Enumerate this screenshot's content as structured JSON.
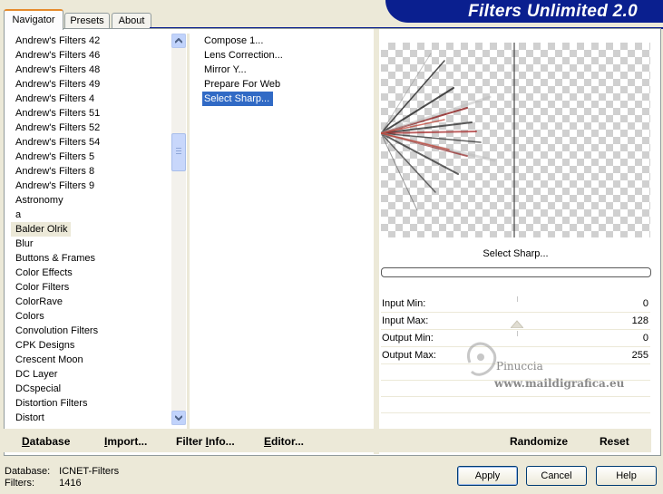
{
  "tabs": [
    {
      "label": "Navigator",
      "active": true
    },
    {
      "label": "Presets",
      "active": false
    },
    {
      "label": "About",
      "active": false
    }
  ],
  "brand": "Filters Unlimited 2.0",
  "categories": [
    "Andrew's Filters 42",
    "Andrew's Filters 46",
    "Andrew's Filters 48",
    "Andrew's Filters 49",
    "Andrew's Filters 4",
    "Andrew's Filters 51",
    "Andrew's Filters 52",
    "Andrew's Filters 54",
    "Andrew's Filters 5",
    "Andrew's Filters 8",
    "Andrew's Filters 9",
    "Astronomy",
    "a",
    "Balder Olrik",
    "Blur",
    "Buttons & Frames",
    "Color Effects",
    "Color Filters",
    "ColorRave",
    "Colors",
    "Convolution Filters",
    "CPK Designs",
    "Crescent Moon",
    "DC Layer",
    "DCspecial",
    "Distortion Filters",
    "Distort"
  ],
  "selected_category": "Balder Olrik",
  "filters": [
    "Compose 1...",
    "Lens Correction...",
    "Mirror Y...",
    "Prepare For Web",
    "Select Sharp..."
  ],
  "selected_filter": "Select Sharp...",
  "preview_label": "Select Sharp...",
  "params": [
    {
      "label": "Input Min:",
      "value": "0"
    },
    {
      "label": "Input Max:",
      "value": "128"
    },
    {
      "label": "Output Min:",
      "value": "0"
    },
    {
      "label": "Output Max:",
      "value": "255"
    }
  ],
  "bottom_bar": {
    "database": {
      "prefix": "D",
      "rest": "atabase"
    },
    "import": {
      "prefix": "I",
      "rest": "mport..."
    },
    "filter_info": {
      "before": "Filter ",
      "prefix": "I",
      "rest": "nfo..."
    },
    "editor": {
      "prefix": "E",
      "rest": "ditor..."
    },
    "randomize": "Randomize",
    "reset": "Reset"
  },
  "footer": {
    "database_label": "Database:",
    "database_value": "ICNET-Filters",
    "filters_label": "Filters:",
    "filters_value": "1416",
    "apply": "Apply",
    "cancel": "Cancel",
    "help": "Help"
  },
  "watermark": {
    "line1": "Pinuccia",
    "line2": "www.maildigrafica.eu"
  }
}
